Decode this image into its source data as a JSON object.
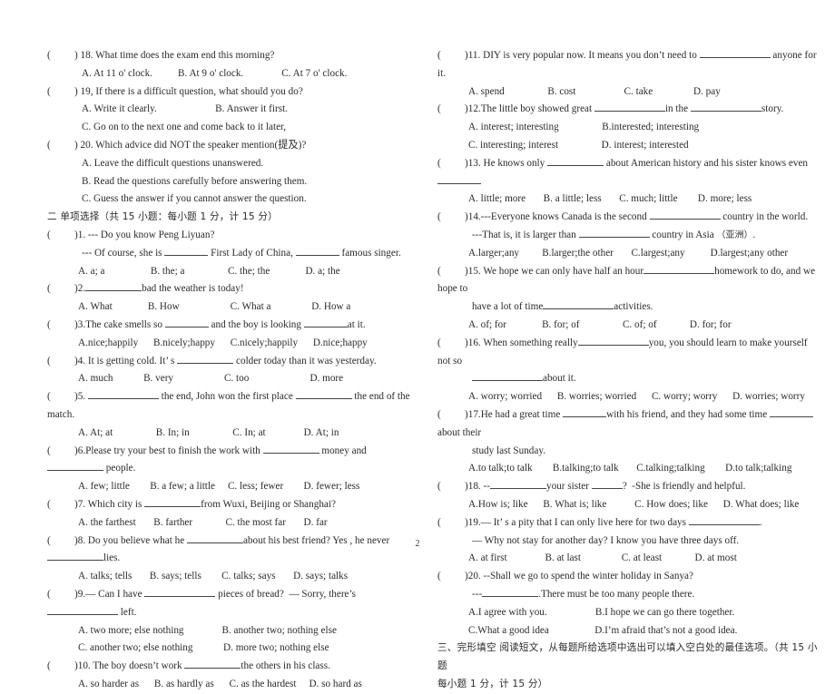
{
  "document": {
    "page_number": "2",
    "type": "english-exam-paper"
  },
  "left_column": {
    "listening_questions": [
      {
        "marker": "(",
        "close": ")",
        "number": "18.",
        "stem": "What time does the exam end this morning?",
        "option_lines": [
          "A. At 11 o' clock.          B. At 9 o' clock.               C. At 7 o' clock."
        ]
      },
      {
        "marker": "(",
        "close": ")",
        "number": "19,",
        "stem": "If there is a difficult question, what should you do?",
        "option_lines": [
          "A. Write it clearly.                       B. Answer it first.",
          "C. Go on to the next one and come back to it later,"
        ]
      },
      {
        "marker": "(",
        "close": ")",
        "number": "20.",
        "stem": "Which advice did NOT the speaker mention(提及)?",
        "option_lines": [
          "A. Leave the difficult questions unanswered.",
          "B. Read the questions carefully before answering them.",
          "C. Guess the answer if you cannot answer the question."
        ]
      }
    ],
    "section_heading": "二 单项选择（共 15 小题：每小题 1 分，计 15 分）",
    "choice_questions": [
      {
        "number": "1.",
        "stem_prefix": "--- Do you know Peng Liyuan?",
        "continuation": [
          {
            "segments": [
              "--- Of course, she is ",
              "BLANK_MD",
              " First Lady of China, ",
              "BLANK_MD",
              " famous singer."
            ]
          }
        ],
        "option_lines": [
          "A. a; a                  B. the; a                 C. the; the              D. a; the"
        ]
      },
      {
        "number": "2.",
        "stem_segments": [
          "",
          "BLANK_LG",
          "bad the weather is today!"
        ],
        "option_lines": [
          "A. What              B. How                    C. What a                D. How a"
        ]
      },
      {
        "number": "3.",
        "stem_segments": [
          "The cake smells so ",
          "BLANK_MD",
          " and the boy is looking ",
          "BLANK_MD",
          "at it."
        ],
        "option_lines": [
          "A.nice;happily      B.nicely;happy      C.nicely;happily      D.nice;happy"
        ]
      },
      {
        "number": "4.",
        "stem_segments": [
          "It is getting cold. It’ s ",
          "BLANK_LG",
          " colder today than it was yesterday."
        ],
        "option_lines": [
          "A. much            B. very                    C. too                        D. more"
        ]
      },
      {
        "number": "5.",
        "stem_segments": [
          "",
          "BLANK_XL",
          " the end, John won the first place ",
          "BLANK_LG",
          " the end of the match."
        ],
        "option_lines": [
          "A. At; at                 B. In; in                 C. In; at               D. At; in"
        ]
      },
      {
        "number": "6.",
        "stem_segments": [
          "Please try your best to finish the work with ",
          "BLANK_LG",
          " money and ",
          "BLANK_LG",
          " people."
        ],
        "option_lines": [
          "A. few; little        B. a few; a little     C. less; fewer        D. fewer; less"
        ]
      },
      {
        "number": "7.",
        "stem_segments": [
          "Which city is ",
          "BLANK_LG",
          "from Wuxi, Beijing or Shanghai?"
        ],
        "option_lines": [
          "A. the farthest       B. farther             C. the most far       D. far"
        ]
      },
      {
        "number": "8.",
        "stem_segments": [
          "Do you believe what he ",
          "BLANK_LG",
          "about his best friend? Yes , he never ",
          "BLANK_LG",
          "lies."
        ],
        "option_lines": [
          "A. talks; tells       B. says; tells        C. talks; says       D. says; talks"
        ]
      },
      {
        "number": "9.",
        "stem_segments": [
          "— Can I have ",
          "BLANK_XL",
          " pieces of bread?      — Sorry, there’s ",
          "BLANK_XL",
          " left."
        ],
        "option_lines": [
          "A. two more; else nothing               B. another two; nothing else",
          "C. another two; else nothing            D. more two; nothing else"
        ]
      },
      {
        "number": "10.",
        "stem_segments": [
          "The boy doesn’t work ",
          "BLANK_LG",
          "the others in his class."
        ],
        "option_lines": [
          "A. so harder as      B. as hardly as      C. as the hardest     D. so hard as"
        ]
      }
    ]
  },
  "right_column": {
    "choice_questions": [
      {
        "number": "11.",
        "stem_segments": [
          "DIY is very popular now. It means you don’t need to ",
          "BLANK_XL",
          " anyone for it."
        ],
        "option_lines": [
          "A. spend                 B. cost                   C. take                D. pay"
        ]
      },
      {
        "number": "12.",
        "stem_segments": [
          "The little boy showed great ",
          "BLANK_XL",
          "in the ",
          "BLANK_XL",
          "story."
        ],
        "option_lines": [
          "A. interest; interesting                 B.interested; interesting",
          "C. interesting; interest                 D. interest; interested"
        ]
      },
      {
        "number": "13.",
        "stem_segments": [
          "He knows only ",
          "BLANK_LG",
          " about American history and his sister knows even",
          "BLANK_MD",
          ""
        ],
        "option_lines": [
          "A. little; more       B. a little; less       C. much; little        D. more; less"
        ]
      },
      {
        "number": "14.",
        "stem_segments": [
          "---Everyone knows Canada is the second ",
          "BLANK_XL",
          " country in the world."
        ],
        "continuation_segments": [
          "---That is, it is larger than ",
          "BLANK_XL",
          " country in Asia （亚洲）."
        ],
        "option_lines": [
          "A.larger;any         B.larger;the other       C.largest;any          D.largest;any other"
        ]
      },
      {
        "number": "15.",
        "stem_segments": [
          "We hope we can only have half an hour",
          "BLANK_XL",
          "homework to do, and we hope to"
        ],
        "continuation_segments": [
          "have a lot of time",
          "BLANK_XL",
          "activities."
        ],
        "option_lines": [
          "A. of; for              B. for; of                 C. of; of             D. for; for"
        ]
      },
      {
        "number": "16.",
        "stem_segments": [
          "When something really",
          "BLANK_XL",
          "you, you should learn to make yourself not so"
        ],
        "continuation_segments": [
          "",
          "BLANK_XL",
          "about it."
        ],
        "option_lines": [
          "A. worry; worried      B. worries; worried      C. worry; worry      D. worries; worry"
        ]
      },
      {
        "number": "17.",
        "stem_segments": [
          "He had a great time ",
          "BLANK_MD",
          "with his friend, and they had some time ",
          "BLANK_MD",
          " about their"
        ],
        "continuation_segments": [
          "study last Sunday."
        ],
        "option_lines": [
          "A.to talk;to talk        B.talking;to talk       C.talking;talking        D.to talk;talking"
        ]
      },
      {
        "number": "18.",
        "stem_segments": [
          "--",
          "BLANK_LG",
          "your sister ",
          "BLANK_SM",
          "?   -She is friendly and helpful."
        ],
        "option_lines": [
          "A.How is; like      B. What is; like           C. How does; like      D. What does; like"
        ]
      },
      {
        "number": "19.",
        "stem_segments": [
          "— It’ s a pity that I can only live here for two days ",
          "BLANK_XL",
          "."
        ],
        "continuation_segments": [
          "— Why not stay for another day? I know you have three days off."
        ],
        "option_lines": [
          "A. at first               B. at last                C. at least             D. at most"
        ]
      },
      {
        "number": "20.",
        "stem_segments": [
          "--Shall we go to spend the winter holiday in Sanya?"
        ],
        "continuation_segments": [
          "---",
          "BLANK_LG",
          ".There must be too many people there."
        ],
        "option_lines": [
          "A.I agree with you.                   B.I hope we can go there together.",
          "C.What a good idea                  D.I’m afraid that’s not a good idea."
        ]
      }
    ],
    "cloze_heading_line1": "三、完形填空 阅读短文，从每题所给选项中选出可以填入空白处的最佳选项。（共 15 小题",
    "cloze_heading_line2": "每小题 1 分，计 15 分）"
  }
}
